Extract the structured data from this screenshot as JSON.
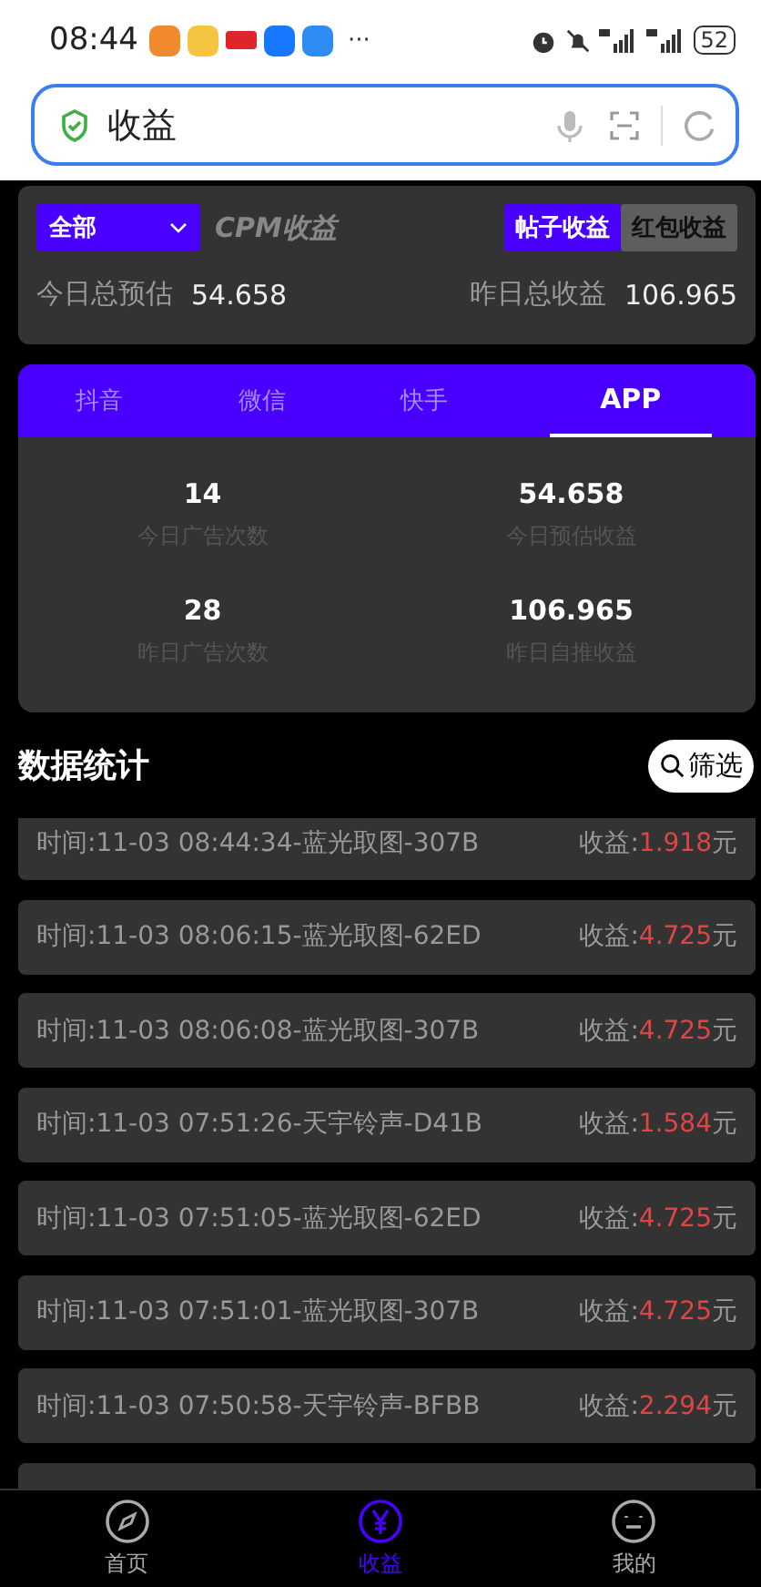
{
  "status_bar": {
    "time": "08:44",
    "more": "···",
    "battery": "52"
  },
  "address_bar": {
    "value": "收益"
  },
  "summary": {
    "filter": "全部",
    "title": "CPM收益",
    "toggles": [
      {
        "label": "帖子收益",
        "selected": true
      },
      {
        "label": "红包收益",
        "selected": false
      }
    ],
    "today_label": "今日总预估",
    "today_value": "54.658",
    "yesterday_label": "昨日总收益",
    "yesterday_value": "106.965"
  },
  "platform_tabs": [
    {
      "label": "抖音",
      "selected": false
    },
    {
      "label": "微信",
      "selected": false
    },
    {
      "label": "快手",
      "selected": false
    },
    {
      "label": "APP",
      "selected": true
    }
  ],
  "stats": [
    {
      "value": "14",
      "label": "今日广告次数"
    },
    {
      "value": "54.658",
      "label": "今日预估收益"
    },
    {
      "value": "28",
      "label": "昨日广告次数"
    },
    {
      "value": "106.965",
      "label": "昨日自推收益"
    }
  ],
  "section": {
    "title": "数据统计",
    "filter_button": "筛选"
  },
  "records": [
    {
      "text": "时间:11-03 08:44:34-蓝光取图-307B",
      "label": "收益:",
      "amount": "1.918",
      "unit": "元"
    },
    {
      "text": "时间:11-03 08:06:15-蓝光取图-62ED",
      "label": "收益:",
      "amount": "4.725",
      "unit": "元"
    },
    {
      "text": "时间:11-03 08:06:08-蓝光取图-307B",
      "label": "收益:",
      "amount": "4.725",
      "unit": "元"
    },
    {
      "text": "时间:11-03 07:51:26-天宇铃声-D41B",
      "label": "收益:",
      "amount": "1.584",
      "unit": "元"
    },
    {
      "text": "时间:11-03 07:51:05-蓝光取图-62ED",
      "label": "收益:",
      "amount": "4.725",
      "unit": "元"
    },
    {
      "text": "时间:11-03 07:51:01-蓝光取图-307B",
      "label": "收益:",
      "amount": "4.725",
      "unit": "元"
    },
    {
      "text": "时间:11-03 07:50:58-天宇铃声-BFBB",
      "label": "收益:",
      "amount": "2.294",
      "unit": "元"
    }
  ],
  "nav": [
    {
      "label": "首页",
      "kind": "compass",
      "selected": false
    },
    {
      "label": "收益",
      "kind": "yen",
      "selected": true
    },
    {
      "label": "我的",
      "kind": "face",
      "selected": false
    }
  ]
}
